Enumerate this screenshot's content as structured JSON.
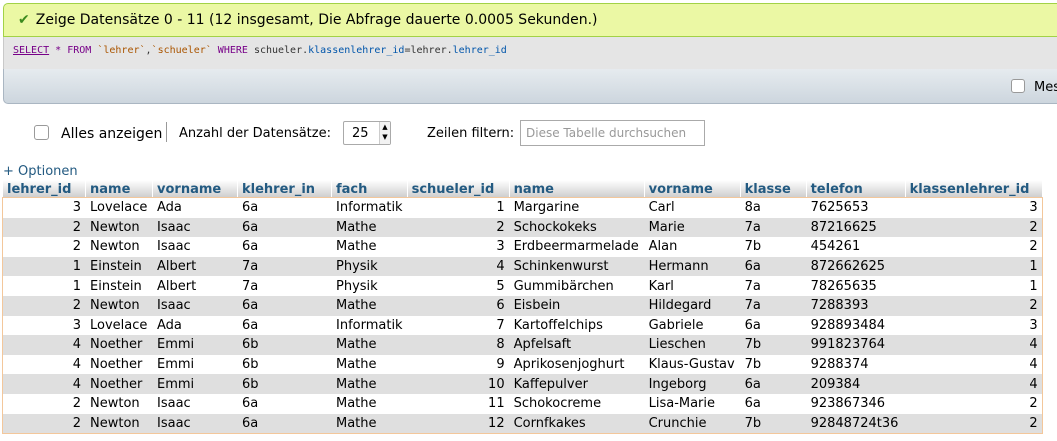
{
  "status": {
    "message": "Zeige Datensätze 0 - 11 (12 insgesamt, Die Abfrage dauerte 0.0005 Sekunden.)",
    "icon": "check-icon"
  },
  "sql": {
    "select": "SELECT",
    "star": "*",
    "from": "FROM",
    "table1": "`lehrer`",
    "comma": ",",
    "table2": "`schueler`",
    "where": "WHERE",
    "cond_left_table": "schueler.",
    "cond_left_col": "klassenlehrer_id",
    "eq": "=",
    "cond_right_table": "lehrer.",
    "cond_right_col": "lehrer_id"
  },
  "toolbar": {
    "mes_label": "Mes"
  },
  "controls": {
    "show_all_label": "Alles anzeigen",
    "count_label": "Anzahl der Datensätze:",
    "count_value": "25",
    "filter_label": "Zeilen filtern:",
    "filter_placeholder": "Diese Tabelle durchsuchen"
  },
  "options_link": "+ Optionen",
  "table": {
    "columns": [
      "lehrer_id",
      "name",
      "vorname",
      "klehrer_in",
      "fach",
      "schueler_id",
      "name",
      "vorname",
      "klasse",
      "telefon",
      "klassenlehrer_id"
    ],
    "rows": [
      [
        "3",
        "Lovelace",
        "Ada",
        "6a",
        "Informatik",
        "1",
        "Margarine",
        "Carl",
        "8a",
        "7625653",
        "3"
      ],
      [
        "2",
        "Newton",
        "Isaac",
        "6a",
        "Mathe",
        "2",
        "Schockokeks",
        "Marie",
        "7a",
        "87216625",
        "2"
      ],
      [
        "2",
        "Newton",
        "Isaac",
        "6a",
        "Mathe",
        "3",
        "Erdbeermarmelade",
        "Alan",
        "7b",
        "454261",
        "2"
      ],
      [
        "1",
        "Einstein",
        "Albert",
        "7a",
        "Physik",
        "4",
        "Schinkenwurst",
        "Hermann",
        "6a",
        "872662625",
        "1"
      ],
      [
        "1",
        "Einstein",
        "Albert",
        "7a",
        "Physik",
        "5",
        "Gummibärchen",
        "Karl",
        "7a",
        "78265635",
        "1"
      ],
      [
        "2",
        "Newton",
        "Isaac",
        "6a",
        "Mathe",
        "6",
        "Eisbein",
        "Hildegard",
        "7a",
        "7288393",
        "2"
      ],
      [
        "3",
        "Lovelace",
        "Ada",
        "6a",
        "Informatik",
        "7",
        "Kartoffelchips",
        "Gabriele",
        "6a",
        "928893484",
        "3"
      ],
      [
        "4",
        "Noether",
        "Emmi",
        "6b",
        "Mathe",
        "8",
        "Apfelsaft",
        "Lieschen",
        "7b",
        "991823764",
        "4"
      ],
      [
        "4",
        "Noether",
        "Emmi",
        "6b",
        "Mathe",
        "9",
        "Aprikosenjoghurt",
        "Klaus-Gustav",
        "7b",
        "9288374",
        "4"
      ],
      [
        "4",
        "Noether",
        "Emmi",
        "6b",
        "Mathe",
        "10",
        "Kaffepulver",
        "Ingeborg",
        "6a",
        "209384",
        "4"
      ],
      [
        "2",
        "Newton",
        "Isaac",
        "6a",
        "Mathe",
        "11",
        "Schokocreme",
        "Lisa-Marie",
        "6a",
        "923867346",
        "2"
      ],
      [
        "2",
        "Newton",
        "Isaac",
        "6a",
        "Mathe",
        "12",
        "Cornfkakes",
        "Crunchie",
        "7b",
        "92848724t36",
        "2"
      ]
    ]
  }
}
